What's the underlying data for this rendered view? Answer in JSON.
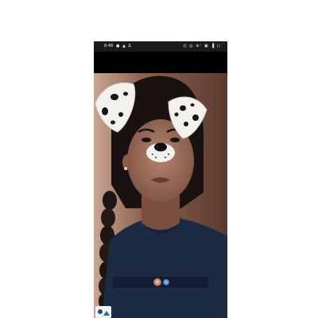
{
  "status_bar": {
    "time": "8:48",
    "left_icons": "● ▲ Δ",
    "right_icons": "◴ ◎ ⊚ᶜ ▣ ▐ ○"
  },
  "lens": {
    "name": "dog-ears-filter"
  },
  "colors": {
    "status_bar_bg": "#1b1b1b",
    "camera_bg": "#6e4a3d",
    "shirt": "#1d2a44",
    "filter_tray": "#0a1223"
  }
}
